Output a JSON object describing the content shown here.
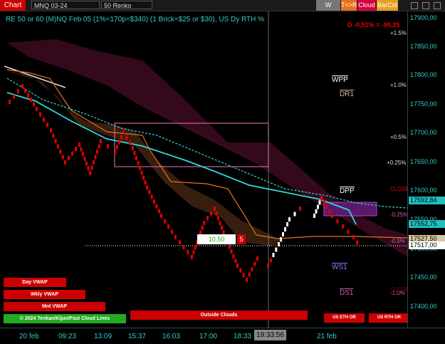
{
  "toolbar": {
    "chart_label": "Chart",
    "instrument": "MNQ 03-24",
    "bar_type": "50 Renko",
    "buttons": [
      {
        "label": "W VWAP",
        "color": "#777"
      },
      {
        "label": "T<>R",
        "color": "#e87020"
      },
      {
        "label": "Cloud",
        "color": "#d40040"
      },
      {
        "label": "BarCol",
        "color": "#e8a020"
      }
    ]
  },
  "title": "RE 50 or 60 (M)NQ Feb 05 (1%=170p=$340) (1 Brick=$25 or $30), US Dy RTH %",
  "change_readout": "D -0,51% = -90,25",
  "price_axis": {
    "ticks": [
      "17900,00",
      "17850,00",
      "17800,00",
      "17750,00",
      "17700,00",
      "17650,00",
      "17600,00",
      "17550,00",
      "17500,00",
      "17450,00",
      "17400,00"
    ],
    "tags": [
      {
        "text": "17592,84",
        "bg": "#20c0c0"
      },
      {
        "text": "17552,75",
        "bg": "#20c0c0"
      },
      {
        "text": "17527,50",
        "bg": "#d8c8a0"
      },
      {
        "text": "17517,00",
        "bg": "#ffffff"
      }
    ]
  },
  "time_axis": [
    "20 feb",
    "09:23",
    "13:09",
    "15:37",
    "16:03",
    "17:00",
    "18:33",
    "19:33:56",
    "21 feb"
  ],
  "pct_labels": [
    "+1.5%",
    "+1.0%",
    "+0.5%",
    "+0.25%",
    "-0.25%",
    "-0.5%",
    "-1.0%"
  ],
  "pivots": {
    "wpp": "WPP",
    "dr1": "DR1",
    "dpp": "DPP",
    "ws1": "WS1",
    "ds1": "DS1",
    "close1": "CLOSE",
    "close2": "CLOSE"
  },
  "box_label": "10,50",
  "box_count": "5",
  "legend_buttons": {
    "day_vwap": "Day VWAP",
    "wkly_vwap": "Wkly VWAP",
    "mnt_vwap": "Mnt VWAP",
    "copyright": "© 2024 Tenkan/Kijun/Fast Cloud Lines",
    "outside_clouds": "Outside Clouds",
    "us_eth_or": "US ETH OR",
    "us_rth_or": "US RTH OR"
  },
  "colors": {
    "cyan": "#3cc",
    "orange": "#e87020",
    "red": "#e00000",
    "white": "#ffffff",
    "pink": "#d060a0"
  }
}
